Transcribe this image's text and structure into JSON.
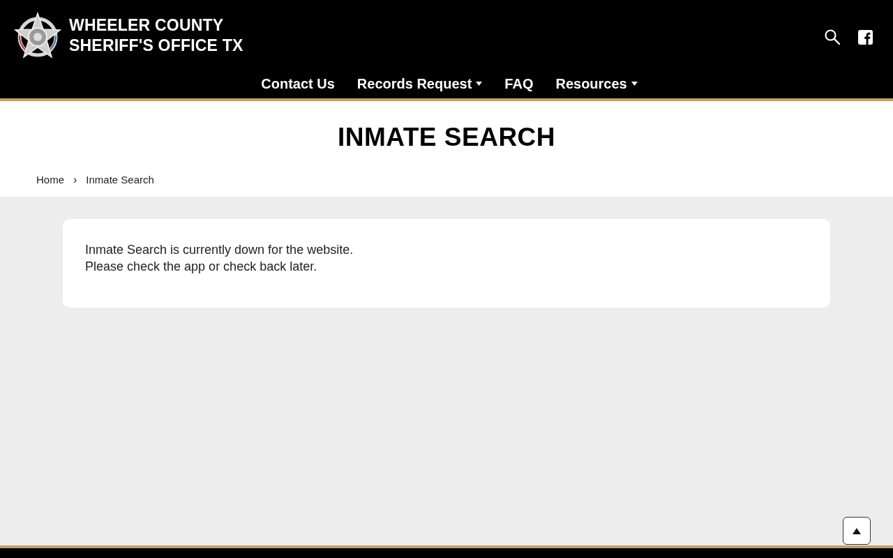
{
  "header": {
    "site_title_lines": [
      "WHEELER COUNTY",
      "SHERIFF'S OFFICE TX"
    ]
  },
  "nav": [
    {
      "label": "Contact Us",
      "has_dropdown": false
    },
    {
      "label": "Records Request",
      "has_dropdown": true
    },
    {
      "label": "FAQ",
      "has_dropdown": false
    },
    {
      "label": "Resources",
      "has_dropdown": true
    }
  ],
  "page_title": "INMATE SEARCH",
  "breadcrumb": {
    "items": [
      "Home",
      "Inmate Search"
    ],
    "separator": "›"
  },
  "notice": {
    "lines": [
      "Inmate Search is currently down for the website.",
      "Please check the app or check back later."
    ]
  }
}
